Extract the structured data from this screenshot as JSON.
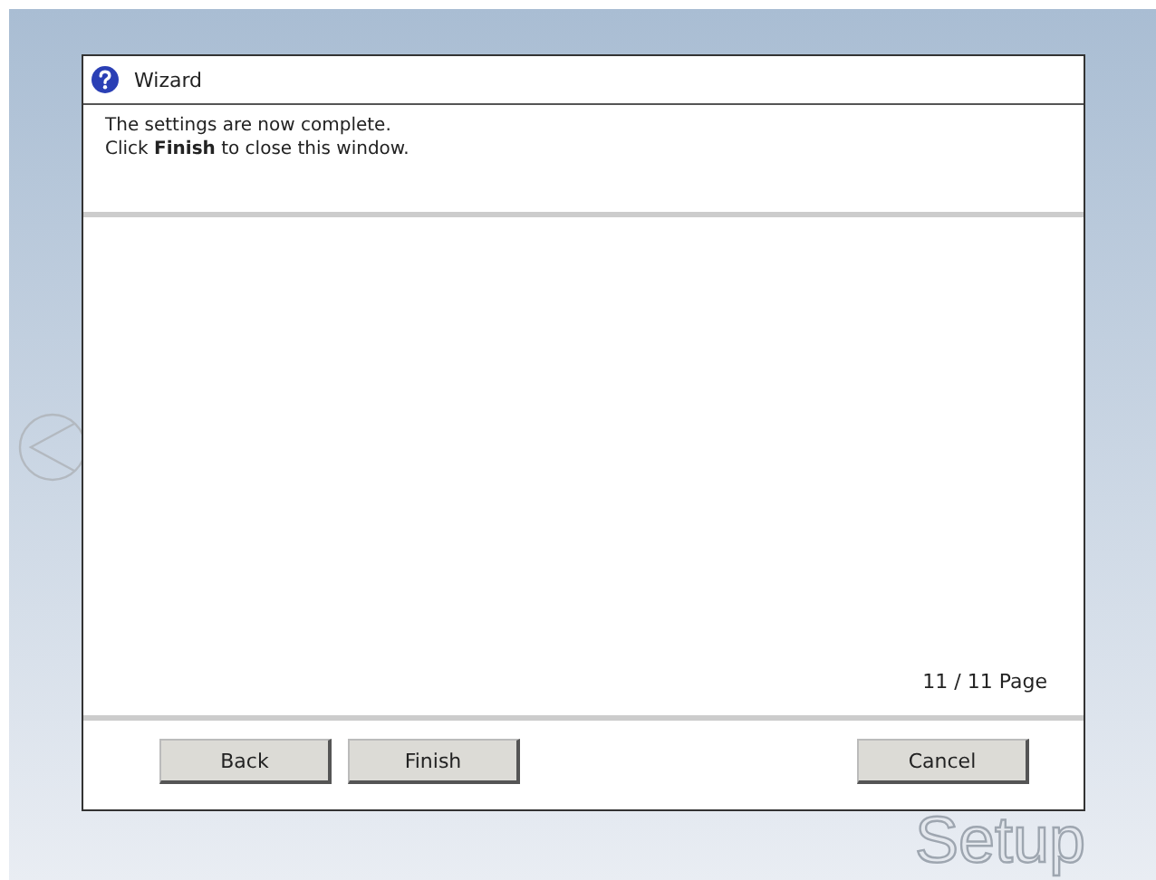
{
  "window": {
    "title": "Wizard"
  },
  "message": [
    "The settings are now complete.",
    "Click **Finish** to close this window."
  ],
  "page_indicator": "11 / 11 Page",
  "buttons": [
    {
      "label": "Back",
      "kind": "nav"
    },
    {
      "label": "Finish",
      "kind": "nav"
    },
    {
      "label": "Cancel",
      "kind": "cancel"
    }
  ],
  "background_label": "Setup"
}
